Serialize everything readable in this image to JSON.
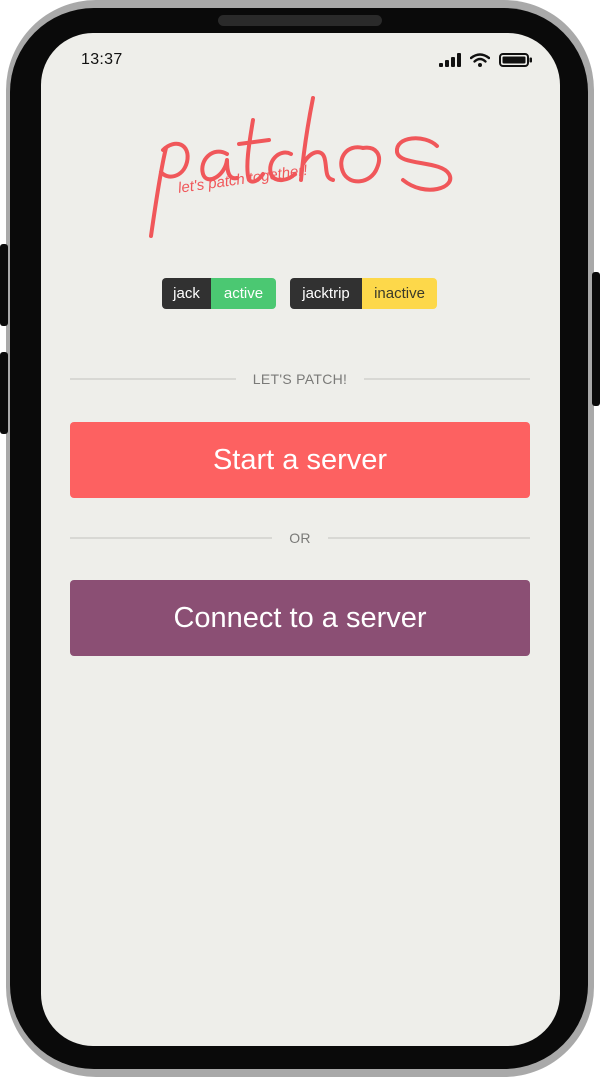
{
  "statusbar": {
    "time": "13:37",
    "icons": [
      "signal-icon",
      "wifi-icon",
      "battery-icon"
    ]
  },
  "logo": {
    "wordmark": "patchOS",
    "tagline": "let's patch together!"
  },
  "badges": {
    "jack": {
      "name": "jack",
      "state": "active"
    },
    "jacktrip": {
      "name": "jacktrip",
      "state": "inactive"
    }
  },
  "dividers": {
    "patch_label": "LET'S PATCH!",
    "or_label": "OR"
  },
  "actions": {
    "start_label": "Start a server",
    "connect_label": "Connect to a server"
  },
  "colors": {
    "background": "#eeeeea",
    "accent_red": "#fd6161",
    "accent_purple": "#8b4f74",
    "active_green": "#4bc872",
    "inactive_yellow": "#fdd84a",
    "badge_dark": "#313131"
  }
}
